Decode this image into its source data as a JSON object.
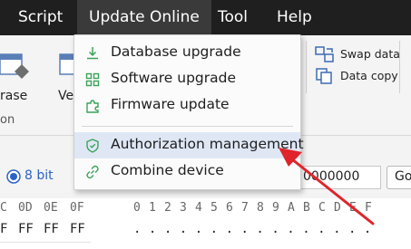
{
  "menubar": {
    "items": [
      {
        "label": "Script"
      },
      {
        "label": "Update Online"
      },
      {
        "label": "Tool"
      },
      {
        "label": "Help"
      }
    ]
  },
  "ribbon": {
    "erase_partial": "rase",
    "verify_partial": "Ve",
    "group_partial": "on",
    "swap_data": "Swap data",
    "data_copy": "Data copy"
  },
  "options": {
    "bit_label": "8 bit",
    "address_value": "0000000",
    "go_partial": "Go"
  },
  "hex": {
    "header_cols": [
      "C",
      "0D",
      "0E",
      "0F"
    ],
    "ascii_header": [
      "0",
      "1",
      "2",
      "3",
      "4",
      "5",
      "6",
      "7",
      "8",
      "9",
      "A",
      "B",
      "C",
      "D",
      "E",
      "F"
    ],
    "row_values": [
      "F",
      "FF",
      "FF",
      "FF"
    ],
    "ascii_row": "................"
  },
  "dropdown": {
    "items": [
      {
        "label": "Database upgrade",
        "icon": "download-icon"
      },
      {
        "label": "Software upgrade",
        "icon": "grid-icon"
      },
      {
        "label": "Firmware update",
        "icon": "puzzle-icon"
      },
      {
        "label": "Authorization management",
        "icon": "shield-icon"
      },
      {
        "label": "Combine device",
        "icon": "link-icon"
      }
    ]
  },
  "colors": {
    "accent_green": "#3aa35a",
    "highlight": "#dfe7f5",
    "arrow_red": "#e0242b",
    "menubar_bg": "#1f1f1f"
  }
}
